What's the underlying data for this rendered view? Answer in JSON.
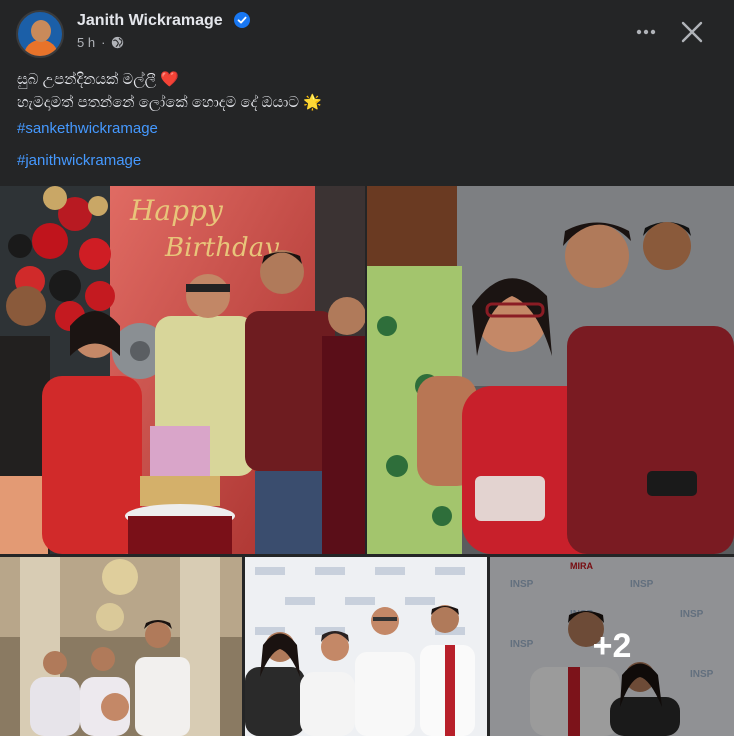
{
  "post": {
    "author": "Janith Wickramage",
    "time": "5 h",
    "caption_line1": "සුබ උපන්දිනයක් මල්ලී ❤️",
    "caption_line2": "හැමදාමත් පතන්නේ ලෝකේ හොදම දේ ඔයාට 🌟",
    "hashtag1": "#sankethwickramage",
    "hashtag2": "#janithwickramage"
  },
  "photos": {
    "p1_banner_line1": "Happy",
    "p1_banner_line2": "Birthday",
    "p5_wall_text": "INSP",
    "p5_wall_logo": "MIRA",
    "more_count": "+2"
  },
  "colors": {
    "background": "#242526",
    "text": "#e4e6eb",
    "secondary_text": "#b0b3b8",
    "link": "#4599ff",
    "verified": "#1877f2"
  },
  "icons": {
    "verified": "verified-badge-icon",
    "privacy": "globe-icon",
    "more": "more-options-icon",
    "close": "close-icon"
  }
}
